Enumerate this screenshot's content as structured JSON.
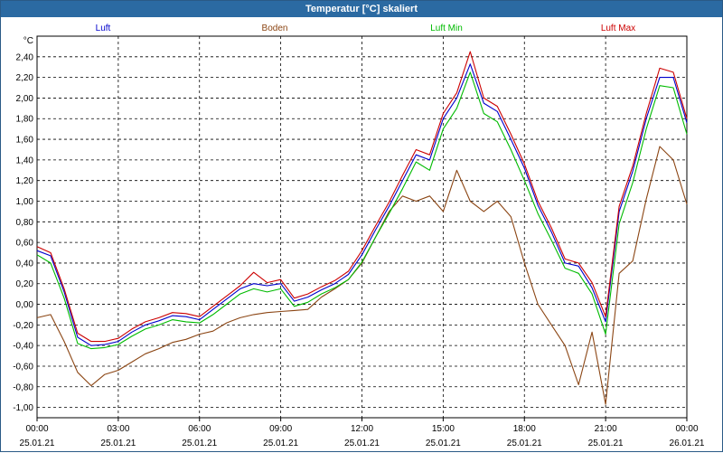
{
  "window": {
    "title": "Temperatur [°C] skaliert"
  },
  "chart_data": {
    "type": "line",
    "title": "Temperatur [°C] skaliert",
    "ylabel": "°C",
    "xlabel": "",
    "ylim": [
      -1.1,
      2.6
    ],
    "xlim": [
      0,
      24
    ],
    "grid": true,
    "legend": "top",
    "y_ticks": [
      "2,40",
      "2,20",
      "2,00",
      "1,80",
      "1,60",
      "1,40",
      "1,20",
      "1,00",
      "0,80",
      "0,60",
      "0,40",
      "0,20",
      "0,00",
      "-0,20",
      "-0,40",
      "-0,60",
      "-0,80",
      "-1,00"
    ],
    "x_ticks": [
      {
        "time": "00:00",
        "date": "25.01.21"
      },
      {
        "time": "03:00",
        "date": "25.01.21"
      },
      {
        "time": "06:00",
        "date": "25.01.21"
      },
      {
        "time": "09:00",
        "date": "25.01.21"
      },
      {
        "time": "12:00",
        "date": "25.01.21"
      },
      {
        "time": "15:00",
        "date": "25.01.21"
      },
      {
        "time": "18:00",
        "date": "25.01.21"
      },
      {
        "time": "21:00",
        "date": "25.01.21"
      },
      {
        "time": "00:00",
        "date": "26.01.21"
      }
    ],
    "x": [
      0,
      0.5,
      1,
      1.5,
      2,
      2.5,
      3,
      3.5,
      4,
      4.5,
      5,
      5.5,
      6,
      6.5,
      7,
      7.5,
      8,
      8.5,
      9,
      9.5,
      10,
      10.5,
      11,
      11.5,
      12,
      12.5,
      13,
      13.5,
      14,
      14.5,
      15,
      15.5,
      16,
      16.5,
      17,
      17.5,
      18,
      18.5,
      19,
      19.5,
      20,
      20.5,
      21,
      21.5,
      22,
      22.5,
      23,
      23.5,
      24
    ],
    "series": [
      {
        "name": "Luft",
        "color": "#0000cc",
        "values": [
          0.52,
          0.47,
          0.12,
          -0.32,
          -0.4,
          -0.39,
          -0.36,
          -0.27,
          -0.2,
          -0.16,
          -0.11,
          -0.12,
          -0.15,
          -0.05,
          0.05,
          0.15,
          0.2,
          0.18,
          0.2,
          0.03,
          0.07,
          0.14,
          0.2,
          0.29,
          0.48,
          0.72,
          0.95,
          1.2,
          1.45,
          1.4,
          1.8,
          2.0,
          2.33,
          1.95,
          1.87,
          1.6,
          1.32,
          0.96,
          0.7,
          0.4,
          0.37,
          0.16,
          -0.17,
          0.9,
          1.29,
          1.8,
          2.2,
          2.2,
          1.76
        ]
      },
      {
        "name": "Boden",
        "color": "#8b4513",
        "values": [
          -0.13,
          -0.1,
          -0.36,
          -0.66,
          -0.79,
          -0.68,
          -0.64,
          -0.56,
          -0.48,
          -0.43,
          -0.37,
          -0.34,
          -0.29,
          -0.26,
          -0.18,
          -0.13,
          -0.1,
          -0.08,
          -0.07,
          -0.06,
          -0.05,
          0.07,
          0.15,
          0.24,
          0.4,
          0.65,
          0.9,
          1.05,
          1.0,
          1.05,
          0.9,
          1.3,
          1.0,
          0.9,
          1.0,
          0.85,
          0.4,
          0.0,
          -0.2,
          -0.4,
          -0.78,
          -0.27,
          -0.97,
          0.3,
          0.42,
          1.02,
          1.53,
          1.4,
          0.97
        ]
      },
      {
        "name": "Luft Min",
        "color": "#00bb00",
        "values": [
          0.48,
          0.4,
          0.06,
          -0.38,
          -0.43,
          -0.42,
          -0.39,
          -0.31,
          -0.24,
          -0.2,
          -0.15,
          -0.17,
          -0.18,
          -0.1,
          0.0,
          0.1,
          0.15,
          0.12,
          0.15,
          -0.02,
          0.02,
          0.1,
          0.16,
          0.24,
          0.41,
          0.65,
          0.88,
          1.12,
          1.38,
          1.3,
          1.7,
          1.9,
          2.25,
          1.85,
          1.77,
          1.5,
          1.2,
          0.88,
          0.62,
          0.35,
          0.3,
          0.1,
          -0.29,
          0.78,
          1.18,
          1.7,
          2.12,
          2.1,
          1.65
        ]
      },
      {
        "name": "Luft Max",
        "color": "#cc0000",
        "values": [
          0.56,
          0.5,
          0.15,
          -0.28,
          -0.36,
          -0.36,
          -0.33,
          -0.24,
          -0.17,
          -0.13,
          -0.08,
          -0.09,
          -0.12,
          -0.02,
          0.08,
          0.18,
          0.31,
          0.21,
          0.24,
          0.06,
          0.1,
          0.17,
          0.23,
          0.32,
          0.52,
          0.76,
          0.99,
          1.25,
          1.5,
          1.45,
          1.85,
          2.05,
          2.45,
          2.0,
          1.92,
          1.65,
          1.36,
          1.0,
          0.74,
          0.44,
          0.4,
          0.21,
          -0.12,
          0.95,
          1.34,
          1.85,
          2.29,
          2.25,
          1.8
        ]
      }
    ]
  }
}
